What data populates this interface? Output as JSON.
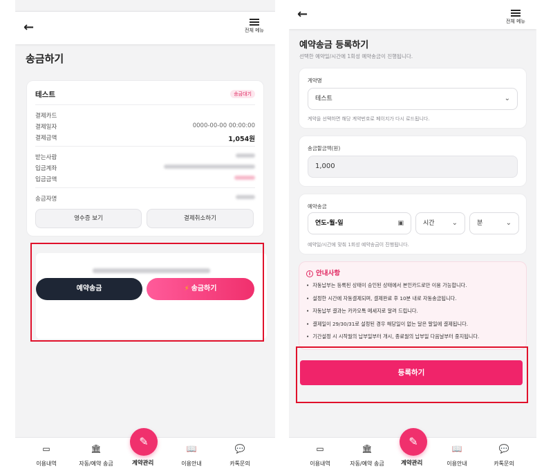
{
  "common": {
    "menu_label": "전체 메뉴",
    "nav": [
      {
        "label": "이용내역",
        "icon": "card-icon"
      },
      {
        "label": "자동/예약 송금",
        "icon": "bank-icon"
      },
      {
        "label": "계약관리",
        "icon": "pencil-icon"
      },
      {
        "label": "이용안내",
        "icon": "book-icon"
      },
      {
        "label": "카톡문의",
        "icon": "chat-icon"
      }
    ],
    "colors": {
      "accent": "#f0306d",
      "dark": "#1e2635",
      "highlight_box": "#e0102a"
    }
  },
  "left": {
    "title": "송금하기",
    "card": {
      "name": "테스트",
      "badge": "송금대기",
      "rows_a": [
        {
          "label": "결제카드",
          "value": ""
        },
        {
          "label": "결제일자",
          "value": "0000-00-00 00:00:00"
        },
        {
          "label": "결제금액",
          "value": "1,054원"
        }
      ],
      "rows_b": [
        {
          "label": "받는사람"
        },
        {
          "label": "입금계좌"
        },
        {
          "label": "입금금액"
        }
      ],
      "rows_c": [
        {
          "label": "송금자명"
        }
      ],
      "receipt_button": "영수증 보기",
      "cancel_button": "결제취소하기"
    },
    "actions": {
      "reserve_button": "예약송금",
      "send_button": "송금하기",
      "send_icon": "⚡"
    }
  },
  "right": {
    "title": "예약송금 등록하기",
    "subtitle": "선택한 예약일/시간에 1회성 예약송금이 진행됩니다.",
    "contract": {
      "label": "계약명",
      "selected": "테스트",
      "help": "계약을 선택하면 해당 계약번호로 페이지가 다시 로드됩니다."
    },
    "amount": {
      "label": "송금할금액(원)",
      "value": "1,000"
    },
    "schedule": {
      "label": "예약송금",
      "date_placeholder": "연도-월-일",
      "hour_placeholder": "시간",
      "minute_placeholder": "분",
      "help": "예약일/시간에 맞춰 1회성 예약송금이 진행됩니다."
    },
    "notice": {
      "title": "안내사항",
      "items": [
        "자동납부는 등록된 상태이 승인된 상태에서 본인카드로만 이용 가능합니다.",
        "설정한 시간에 자동결제되며, 결제완료 후 10분 내로 자동송금됩니다.",
        "자동납부 결과는 카카오톡 메세지로 알려 드립니다.",
        "결제일이 29/30/31로 설정된 경우 해당일이 없는 달은 말일에 결제됩니다.",
        "기간설정 시 시작월의 납부일부터 개시, 종료월의 납부일 다음날부터 중지됩니다."
      ]
    },
    "submit_button": "등록하기"
  }
}
